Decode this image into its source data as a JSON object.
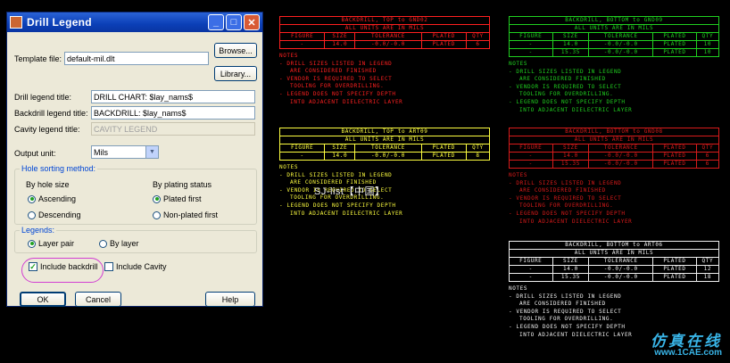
{
  "dialog": {
    "title": "Drill Legend",
    "template_file_label": "Template file:",
    "template_file_value": "default-mil.dlt",
    "browse_label": "Browse...",
    "library_label": "Library...",
    "drill_title_label": "Drill legend title:",
    "drill_title_value": "DRILL CHART: $lay_nams$",
    "backdrill_title_label": "Backdrill legend title:",
    "backdrill_title_value": "BACKDRILL: $lay_nams$",
    "cavity_title_label": "Cavity legend title:",
    "cavity_title_value": "CAVITY LEGEND",
    "output_unit_label": "Output unit:",
    "output_unit_value": "Mils",
    "hole_sorting": {
      "title": "Hole sorting method:",
      "by_size_label": "By hole size",
      "by_plating_label": "By plating status",
      "ascending": "Ascending",
      "descending": "Descending",
      "plated_first": "Plated first",
      "nonplated_first": "Non-plated first"
    },
    "legends": {
      "title": "Legends:",
      "layer_pair": "Layer pair",
      "by_layer": "By layer"
    },
    "include_backdrill": "Include backdrill",
    "include_cavity": "Include Cavity",
    "ok_label": "OK",
    "cancel_label": "Cancel",
    "help_label": "Help"
  },
  "legend_headers": {
    "units": "ALL UNITS ARE IN MILS",
    "figure": "FIGURE",
    "size": "SIZE",
    "tolerance": "TOLERANCE",
    "plated": "PLATED",
    "qty": "QTY"
  },
  "notes": {
    "title": "NOTES",
    "l1": "- DRILL SIZES LISTED IN LEGEND",
    "l2": "  ARE CONSIDERED FINISHED",
    "l3": "- VENDOR IS REQUIRED TO SELECT",
    "l4": "  TOOLING FOR OVERDRILLING.",
    "l5": "- LEGEND DOES NOT SPECIFY DEPTH",
    "l6": "  INTO ADJACENT DIELECTRIC LAYER"
  },
  "legend_red": {
    "title": "BACKDRILL, TOP to GND02",
    "row1": {
      "figure": "-",
      "size": "14.0",
      "tolerance": "-0.0/-0.0",
      "plated": "PLATED",
      "qty": "6"
    }
  },
  "legend_green": {
    "title": "BACKDRILL, BOTTOM to GND09",
    "row1": {
      "figure": "-",
      "size": "14.0",
      "tolerance": "-0.0/-0.0",
      "plated": "PLATED",
      "qty": "10"
    },
    "row2": {
      "figure": "-",
      "size": "15.35",
      "tolerance": "-0.0/-0.0",
      "plated": "PLATED",
      "qty": "10"
    }
  },
  "legend_yellow": {
    "title": "BACKDRILL, TOP to ART09",
    "row1": {
      "figure": "-",
      "size": "14.0",
      "tolerance": "-0.0/-0.0",
      "plated": "PLATED",
      "qty": "8"
    }
  },
  "legend_red2": {
    "title": "BACKDRILL, BOTTOM to GND08",
    "row1": {
      "figure": "-",
      "size": "14.0",
      "tolerance": "-0.0/-0.0",
      "plated": "PLATED",
      "qty": "6"
    },
    "row2": {
      "figure": "-",
      "size": "15.35",
      "tolerance": "-0.0/-0.0",
      "plated": "PLATED",
      "qty": "6"
    }
  },
  "legend_white": {
    "title": "BACKDRILL, BOTTOM to ART06",
    "row1": {
      "figure": "-",
      "size": "14.0",
      "tolerance": "-0.0/-0.0",
      "plated": "PLATED",
      "qty": "12"
    },
    "row2": {
      "figure": "-",
      "size": "15.35",
      "tolerance": "-0.0/-0.0",
      "plated": "PLATED",
      "qty": "18"
    }
  },
  "overlay_text": "SJ-list【中国】",
  "watermark": {
    "line1": "仿真在线",
    "line2": "www.1CAE.com"
  },
  "colors": {
    "red": "#ff2020",
    "green": "#20d020",
    "yellow": "#ffff40",
    "white": "#f0f0f0",
    "title_bar": "#0b3fb7"
  }
}
